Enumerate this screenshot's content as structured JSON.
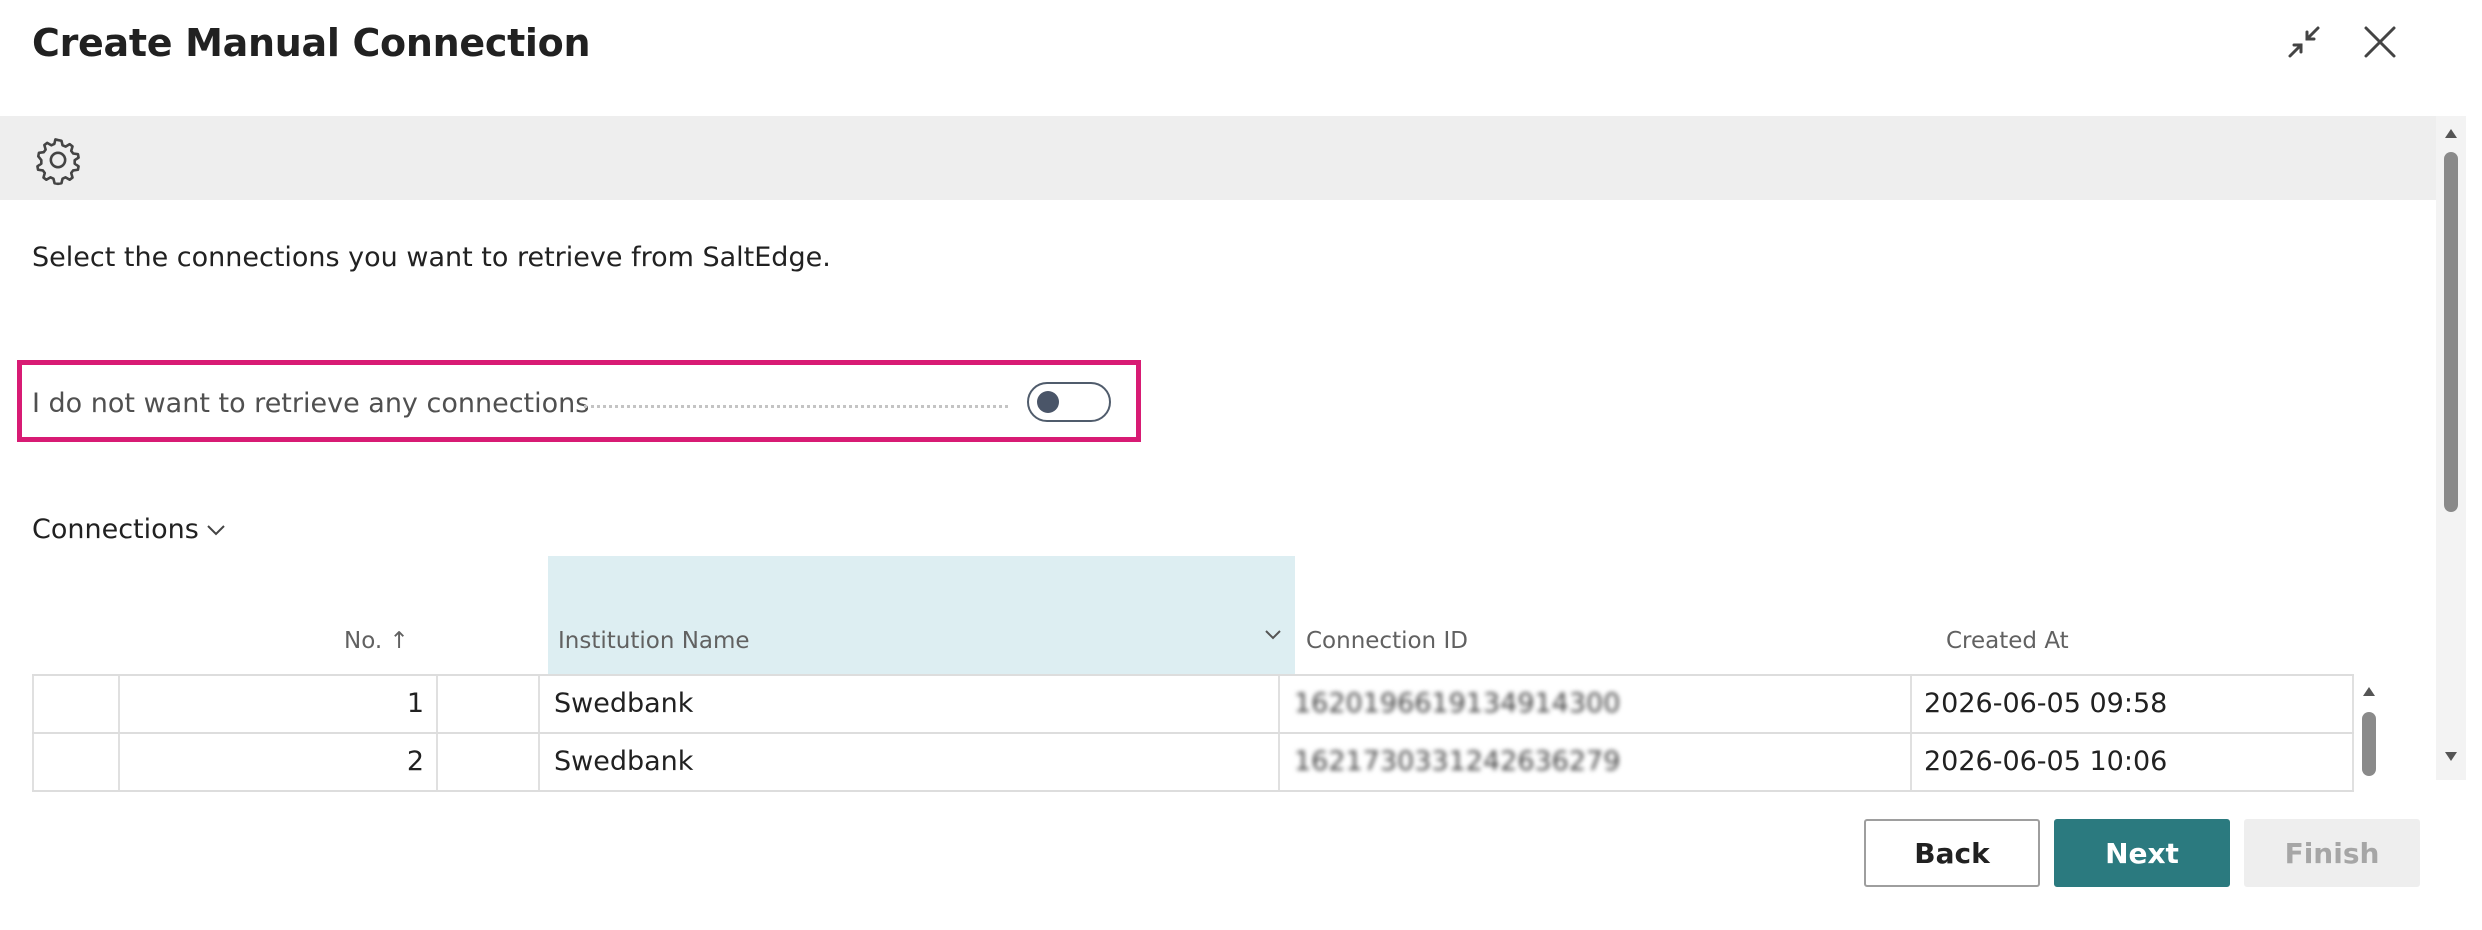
{
  "dialog": {
    "title": "Create Manual Connection",
    "icons": {
      "collapse": "collapse-icon",
      "close": "close-icon",
      "settings": "gear-icon"
    }
  },
  "instruction": "Select the connections you want to retrieve from SaltEdge.",
  "option": {
    "label": "I do not want to retrieve any connections",
    "value": false,
    "highlight_color": "#d81b74"
  },
  "connections": {
    "group_label": "Connections",
    "columns": {
      "no": "No.",
      "no_sort": "↑",
      "institution": "Institution Name",
      "connection_id": "Connection ID",
      "created_at": "Created At"
    },
    "rows": [
      {
        "no": "1",
        "institution": "Swedbank",
        "connection_id": "1620196619134914300",
        "created_at": "2026-06-05 09:58"
      },
      {
        "no": "2",
        "institution": "Swedbank",
        "connection_id": "1621730331242636279",
        "created_at": "2026-06-05 10:06"
      }
    ]
  },
  "buttons": {
    "back": "Back",
    "next": "Next",
    "finish": "Finish"
  },
  "colors": {
    "accent": "#2b7a7f",
    "selected_column": "#ddeef2",
    "toolbar": "#eeeeee"
  }
}
